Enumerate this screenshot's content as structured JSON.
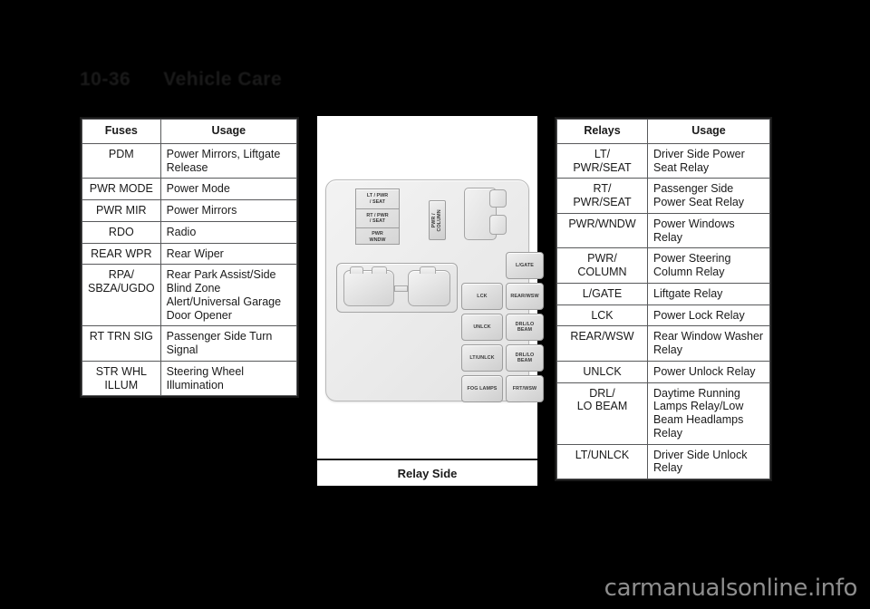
{
  "header": {
    "page_number": "10-36",
    "section_title": "Vehicle Care"
  },
  "fuse_table": {
    "columns": [
      "Fuses",
      "Usage"
    ],
    "rows": [
      {
        "fuse": "PDM",
        "usage": "Power Mirrors, Liftgate Release"
      },
      {
        "fuse": "PWR MODE",
        "usage": "Power Mode"
      },
      {
        "fuse": "PWR MIR",
        "usage": "Power Mirrors"
      },
      {
        "fuse": "RDO",
        "usage": "Radio"
      },
      {
        "fuse": "REAR WPR",
        "usage": "Rear Wiper"
      },
      {
        "fuse": "RPA/\nSBZA/UGDO",
        "usage": "Rear Park Assist/Side Blind Zone Alert/Universal Garage Door Opener"
      },
      {
        "fuse": "RT TRN SIG",
        "usage": "Passenger Side Turn Signal"
      },
      {
        "fuse": "STR WHL\nILLUM",
        "usage": "Steering Wheel Illumination"
      }
    ]
  },
  "relay_table": {
    "columns": [
      "Relays",
      "Usage"
    ],
    "rows": [
      {
        "relay": "LT/\nPWR/SEAT",
        "usage": "Driver Side Power Seat Relay"
      },
      {
        "relay": "RT/\nPWR/SEAT",
        "usage": "Passenger Side Power Seat Relay"
      },
      {
        "relay": "PWR/WNDW",
        "usage": "Power Windows Relay"
      },
      {
        "relay": "PWR/\nCOLUMN",
        "usage": "Power Steering Column Relay"
      },
      {
        "relay": "L/GATE",
        "usage": "Liftgate Relay"
      },
      {
        "relay": "LCK",
        "usage": "Power Lock Relay"
      },
      {
        "relay": "REAR/WSW",
        "usage": "Rear Window Washer Relay"
      },
      {
        "relay": "UNLCK",
        "usage": "Power Unlock Relay"
      },
      {
        "relay": "DRL/\nLO BEAM",
        "usage": "Daytime Running Lamps Relay/Low Beam Headlamps Relay"
      },
      {
        "relay": "LT/UNLCK",
        "usage": "Driver Side Unlock Relay"
      }
    ]
  },
  "diagram": {
    "caption": "Relay Side",
    "stack_seats": [
      "LT / PWR\n/ SEAT",
      "RT / PWR\n/ SEAT",
      "PWR\nWNDW"
    ],
    "pwr_column_label": "PWR /\nCOLUMN",
    "mid_column": [
      "LCK",
      "UNLCK",
      "LT/UNLCK",
      "FOG LAMPS"
    ],
    "right_column": [
      "L/GATE",
      "REAR/WSW",
      "DRL/LO\nBEAM",
      "DRL/LO\nBEAM",
      "FRT/WSW"
    ]
  },
  "watermark": "carmanualsonline.info"
}
